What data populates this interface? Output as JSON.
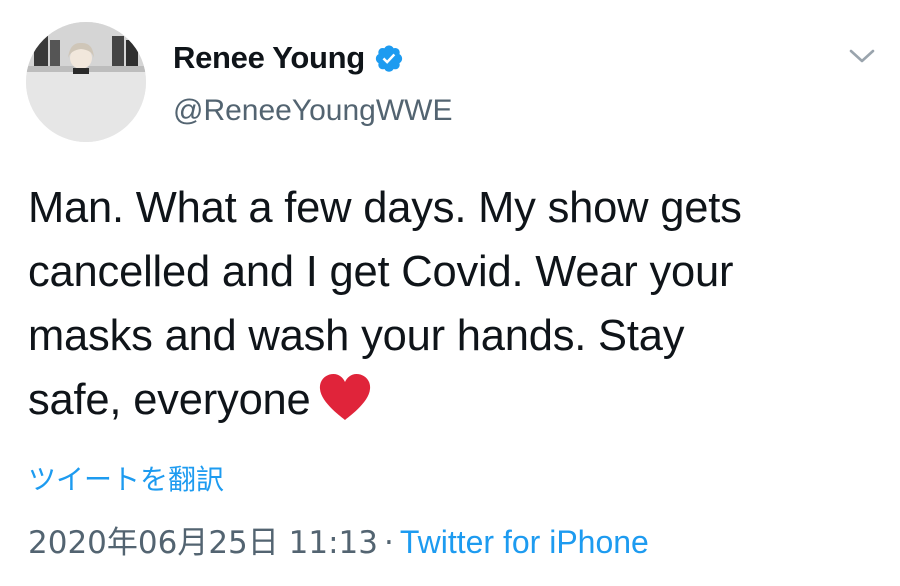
{
  "author": {
    "display_name": "Renee Young",
    "handle": "@ReneeYoungWWE",
    "verified": true
  },
  "tweet": {
    "text_lines": [
      "Man. What a few days. My show gets",
      "cancelled and I get Covid. Wear your",
      "masks and wash your hands. Stay",
      "safe, everyone"
    ],
    "emoji": "red-heart"
  },
  "translate_label": "ツイートを翻訳",
  "meta": {
    "timestamp": "2020年06月25日 11:13",
    "separator": "·",
    "source": "Twitter for iPhone"
  },
  "icons": {
    "verified": "verified-badge-icon",
    "caret": "chevron-down-icon"
  },
  "colors": {
    "link_blue": "#1d9bf0",
    "verified_blue": "#1d9bf0",
    "secondary_text": "#536471",
    "heart_red": "#e0243a"
  }
}
